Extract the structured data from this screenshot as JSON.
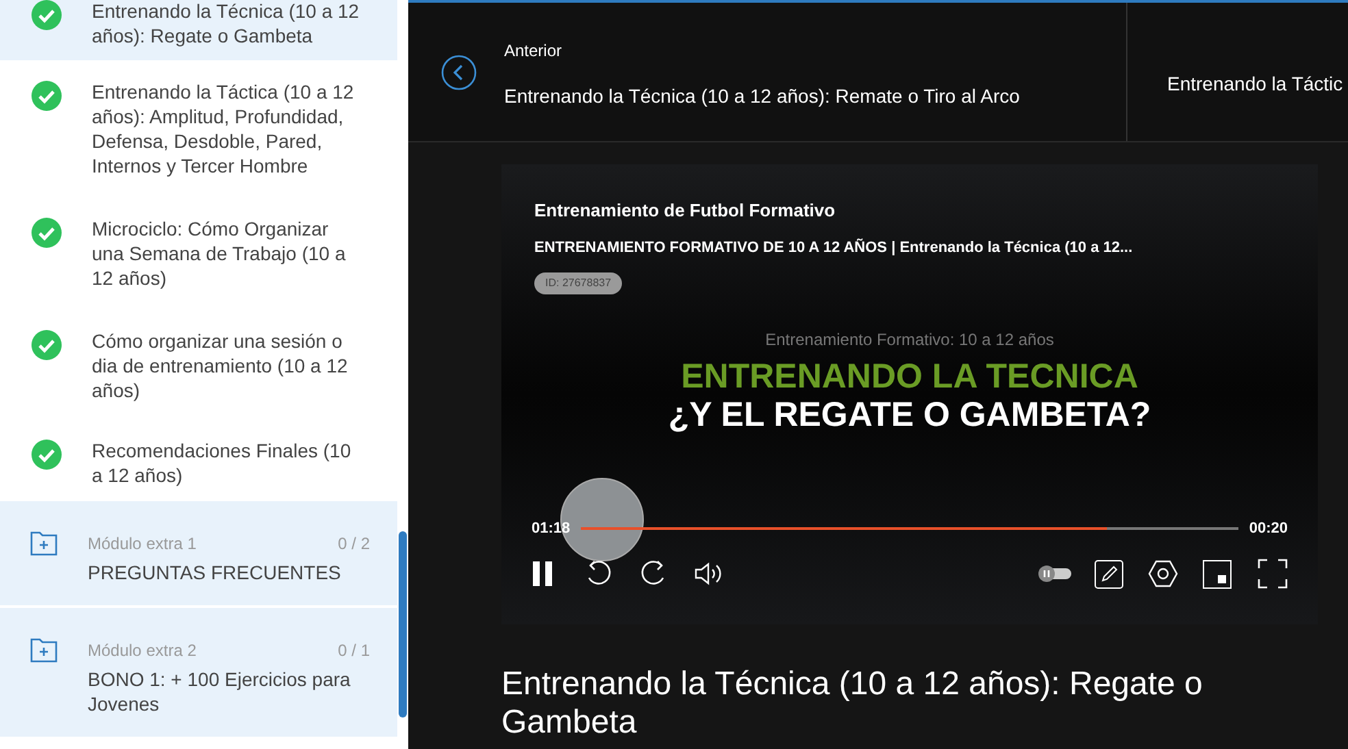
{
  "sidebar": {
    "items": [
      {
        "kind": "lesson",
        "title": "Entrenando la Técnica (10 a 12 años): Regate o Gambeta",
        "completed": true,
        "selected": true
      },
      {
        "kind": "lesson",
        "title": "Entrenando la Táctica (10 a 12 años): Amplitud, Profundidad, Defensa, Desdoble, Pared, Internos y Tercer Hombre",
        "completed": true,
        "selected": false
      },
      {
        "kind": "lesson",
        "title": "Microciclo: Cómo Organizar una Semana de Trabajo (10 a 12 años)",
        "completed": true,
        "selected": false
      },
      {
        "kind": "lesson",
        "title": "Cómo organizar una sesión o dia de entrenamiento (10 a 12 años)",
        "completed": true,
        "selected": false
      },
      {
        "kind": "lesson",
        "title": "Recomendaciones Finales (10 a 12 años)",
        "completed": true,
        "selected": false
      },
      {
        "kind": "module",
        "label": "Módulo extra 1",
        "count": "0 / 2",
        "title": "PREGUNTAS FRECUENTES"
      },
      {
        "kind": "module",
        "label": "Módulo extra 2",
        "count": "0 / 1",
        "title": "BONO 1: + 100 Ejercicios para Jovenes"
      }
    ]
  },
  "nav": {
    "previous": {
      "label": "Anterior",
      "title": "Entrenando la Técnica (10 a 12 años): Remate o Tiro al Arco"
    },
    "next": {
      "title": "Entrenando la Táctic"
    }
  },
  "player": {
    "channel": "Entrenamiento de Futbol Formativo",
    "video_title": "ENTRENAMIENTO FORMATIVO DE 10 A 12 AÑOS | Entrenando la Técnica (10 a 12...",
    "id": "ID: 27678837",
    "frame": {
      "subtitle": "Entrenamiento Formativo:  10 a 12 años",
      "headline": "ENTRENANDO LA TECNICA",
      "question": "¿Y EL REGATE O GAMBETA?"
    },
    "elapsed": "01:18",
    "remaining": "00:20",
    "level": 0.8,
    "playing": true
  },
  "lesson_title": "Entrenando la Técnica (10 a 12 años): Regate o Gambeta"
}
